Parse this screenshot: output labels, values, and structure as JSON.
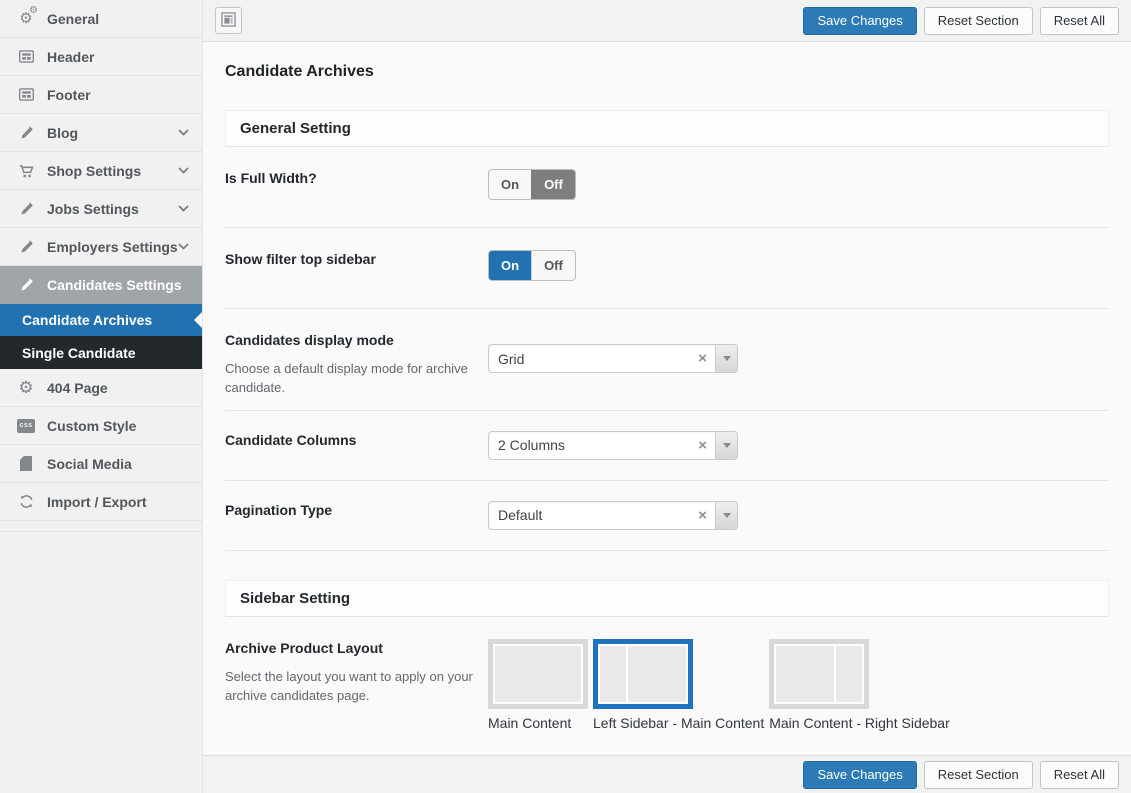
{
  "colors": {
    "accent_blue": "#2271b1",
    "selected_layout_border": "#1e73be",
    "toggle_off_active_gray": "#7e7e7e",
    "sidebar_bg": "#f1f1f1",
    "active_parent_bg": "#a0a5aa",
    "dark_submenu_bg": "#23282d"
  },
  "sidebar": {
    "items": [
      {
        "label": "General",
        "icon": "gears-icon"
      },
      {
        "label": "Header",
        "icon": "header-icon"
      },
      {
        "label": "Footer",
        "icon": "footer-icon"
      },
      {
        "label": "Blog",
        "icon": "pencil-icon",
        "expandable": true
      },
      {
        "label": "Shop Settings",
        "icon": "cart-icon",
        "expandable": true
      },
      {
        "label": "Jobs Settings",
        "icon": "pencil-icon",
        "expandable": true
      },
      {
        "label": "Employers Settings",
        "icon": "pencil-icon",
        "expandable": true
      },
      {
        "label": "Candidates Settings",
        "icon": "pencil-icon",
        "state": "active-parent"
      },
      {
        "label": "Candidate Archives",
        "submenu": true,
        "state": "active"
      },
      {
        "label": "Single Candidate",
        "submenu": true,
        "state": "sibling-open"
      },
      {
        "label": "404 Page",
        "icon": "gear-icon"
      },
      {
        "label": "Custom Style",
        "icon": "css-icon"
      },
      {
        "label": "Social Media",
        "icon": "page-icon"
      },
      {
        "label": "Import / Export",
        "icon": "sync-icon"
      }
    ]
  },
  "actions": {
    "save": "Save Changes",
    "reset_section": "Reset Section",
    "reset_all": "Reset All"
  },
  "page": {
    "title": "Candidate Archives"
  },
  "sections": {
    "general": "General Setting",
    "sidebar": "Sidebar Setting"
  },
  "fields": {
    "full_width": {
      "label": "Is Full Width?",
      "on_label": "On",
      "off_label": "Off",
      "value": "Off"
    },
    "filter_top_sidebar": {
      "label": "Show filter top sidebar",
      "on_label": "On",
      "off_label": "Off",
      "value": "On"
    },
    "display_mode": {
      "label": "Candidates display mode",
      "description": "Choose a default display mode for archive candidate.",
      "value": "Grid",
      "clear_icon": "×"
    },
    "candidate_columns": {
      "label": "Candidate Columns",
      "value": "2 Columns",
      "clear_icon": "×"
    },
    "pagination_type": {
      "label": "Pagination Type",
      "value": "Default",
      "clear_icon": "×"
    },
    "archive_layout": {
      "label": "Archive Product Layout",
      "description": "Select the layout you want to apply on your archive candidates page.",
      "selected_value": "Left Sidebar - Main Content",
      "options": [
        {
          "label": "Main Content",
          "type": "main-only",
          "selected": false
        },
        {
          "label": "Left Sidebar - Main Content",
          "type": "left-sidebar",
          "selected": true
        },
        {
          "label": "Main Content - Right Sidebar",
          "type": "right-sidebar",
          "selected": false
        }
      ]
    }
  }
}
